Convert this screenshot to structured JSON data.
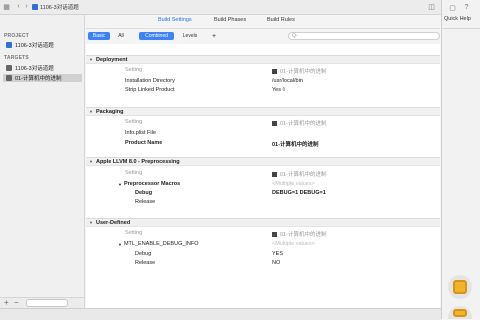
{
  "breadcrumb": {
    "project": "1106-3对话道题"
  },
  "tabs": {
    "build_settings": "Build Settings",
    "build_phases": "Build Phases",
    "build_rules": "Build Rules"
  },
  "sidebar": {
    "project_header": "PROJECT",
    "project_item": "1106-3对话道题",
    "targets_header": "TARGETS",
    "targets": [
      "1106-3对话道题",
      "01-计算机中的进制"
    ]
  },
  "filter": {
    "basic": "Basic",
    "all": "All",
    "combined": "Combined",
    "levels": "Levels",
    "add": "+",
    "search_placeholder": "Q-"
  },
  "quick_help": {
    "title": "Quick Help"
  },
  "sections": {
    "deployment": {
      "title": "Deployment",
      "setting": "Setting",
      "target_col": "01-计算机中的进制",
      "rows": [
        {
          "label": "Installation Directory",
          "value": "/usr/local/bin"
        },
        {
          "label": "Strip Linked Product",
          "value": "Yes ◊"
        }
      ]
    },
    "packaging": {
      "title": "Packaging",
      "setting": "Setting",
      "target_col": "01-计算机中的进制",
      "rows": [
        {
          "label": "Info.plist File",
          "value": ""
        },
        {
          "label": "Product Name",
          "value": "01-计算机中的进制"
        }
      ]
    },
    "llvm": {
      "title": "Apple LLVM 8.0 - Preprocessing",
      "setting": "Setting",
      "target_col": "01-计算机中的进制",
      "macro_label": "Preprocessor Macros",
      "macro_value": "<Multiple values>",
      "debug_label": "Debug",
      "debug_value": "DEBUG=1 DEBUG=1",
      "release_label": "Release"
    },
    "user_defined": {
      "title": "User-Defined",
      "setting": "Setting",
      "target_col": "01-计算机中的进制",
      "mtl_label": "MTL_ENABLE_DEBUG_INFO",
      "mtl_value": "<Multiple values>",
      "debug_label": "Debug",
      "debug_value": "YES",
      "release_label": "Release",
      "release_value": "NO"
    }
  }
}
